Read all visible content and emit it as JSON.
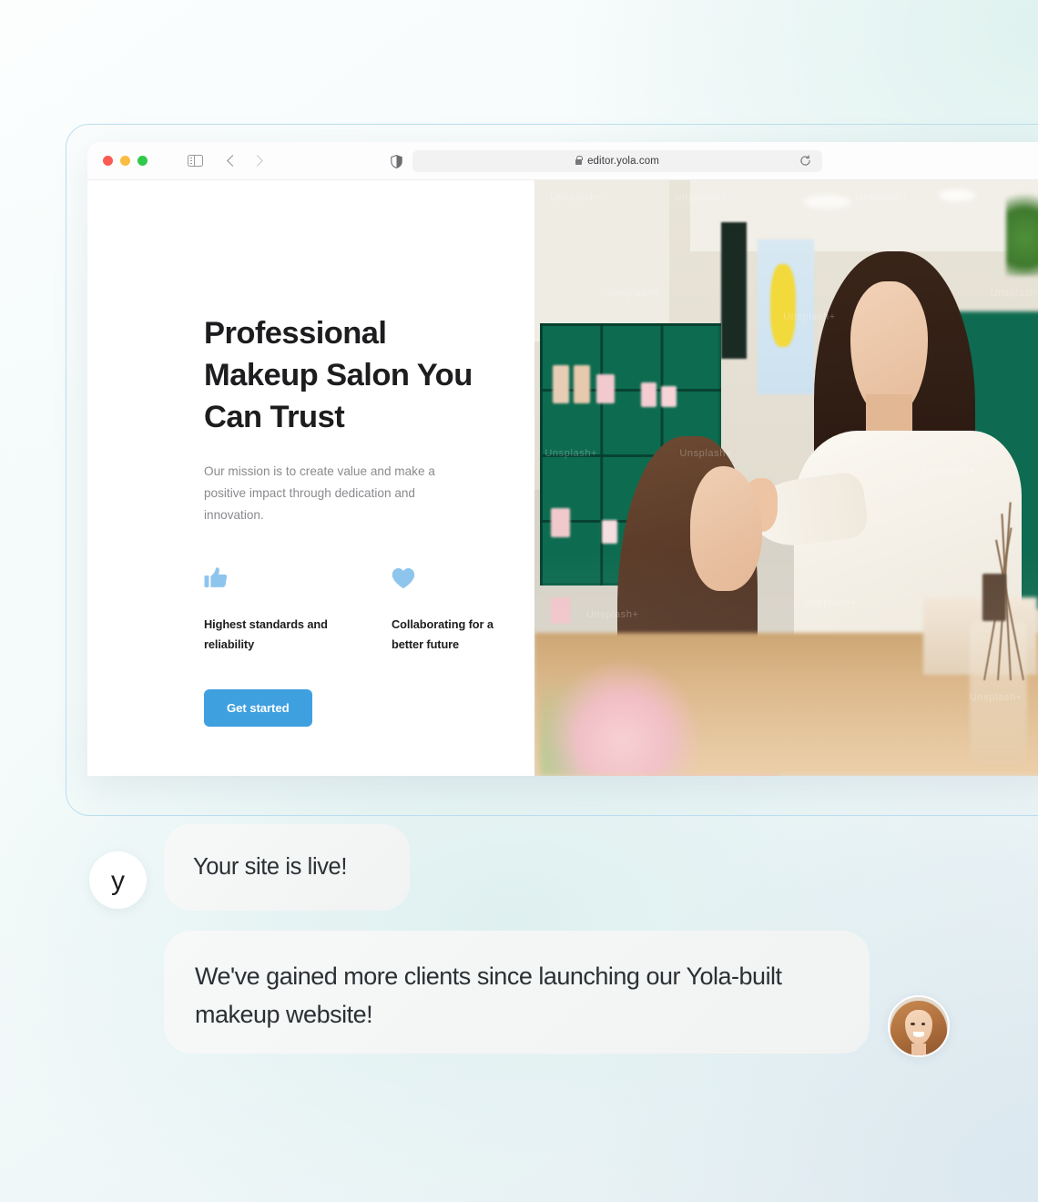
{
  "browser": {
    "url": "editor.yola.com",
    "traffic_lights": [
      "close",
      "minimize",
      "maximize"
    ],
    "icons": {
      "sidebar": "sidebar-toggle-icon",
      "back": "chevron-left-icon",
      "forward": "chevron-right-icon",
      "shield": "shield-icon",
      "lock": "lock-icon",
      "reload": "reload-icon"
    }
  },
  "site": {
    "headline": "Professional Makeup Salon You Can Trust",
    "subtitle": "Our mission is to create value and make a positive impact through dedication and innovation.",
    "features": [
      {
        "icon": "thumbs-up-icon",
        "label": "Highest standards and reliability"
      },
      {
        "icon": "heart-icon",
        "label": "Collaborating for a better future"
      }
    ],
    "cta_label": "Get started",
    "hero_watermarks": [
      "Unsplash+",
      "Unsplash+",
      "Unsplash+",
      "Unsplash+",
      "Unsplash+",
      "Unsplash+",
      "Unsplash+",
      "Unsplash+",
      "Unsplash+",
      "Unsplash+",
      "Unsplash+",
      "Unsplash+"
    ]
  },
  "chat": {
    "brand_mark": "y",
    "messages": [
      {
        "from": "yola",
        "text": "Your site is live!"
      },
      {
        "from": "client",
        "text": "We've gained more clients since launching our Yola-built makeup website!"
      }
    ]
  },
  "colors": {
    "cta_blue": "#3fa0e0",
    "feature_icon_blue": "#8ec5ec",
    "heading_dark": "#1d1d1f",
    "body_gray": "#8b8b8f",
    "bubble_bg": "#f4f6f6",
    "frame_border": "#bcdff0"
  }
}
